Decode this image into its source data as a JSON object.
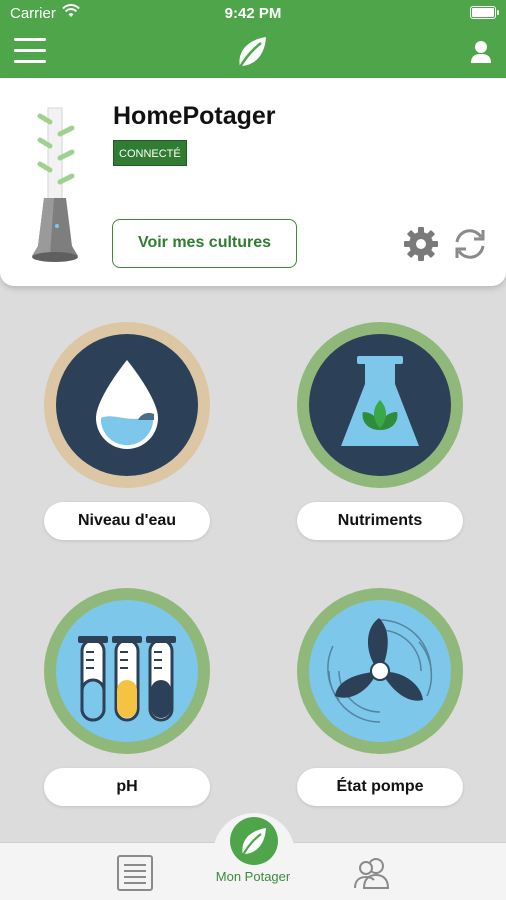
{
  "status_bar": {
    "carrier": "Carrier",
    "time": "9:42 PM"
  },
  "nav": {
    "menu_icon": "hamburger-menu-icon",
    "logo_icon": "leaf-logo-icon",
    "profile_icon": "user-profile-icon"
  },
  "device": {
    "name": "HomePotager",
    "status": "CONNECTÉ",
    "cultures_button": "Voir mes cultures",
    "settings_icon": "gear-icon",
    "refresh_icon": "refresh-icon"
  },
  "tiles": [
    {
      "label": "Niveau d'eau",
      "icon": "water-drop-icon",
      "ring_color": "#dcc6a3"
    },
    {
      "label": "Nutriments",
      "icon": "flask-leaves-icon",
      "ring_color": "#8fb87a"
    },
    {
      "label": "pH",
      "icon": "test-tubes-icon",
      "ring_color": "#8fb87a"
    },
    {
      "label": "État pompe",
      "icon": "fan-icon",
      "ring_color": "#8fb87a"
    }
  ],
  "tab_bar": {
    "center_label": "Mon Potager",
    "list_icon": "list-icon",
    "users_icon": "users-icon"
  },
  "colors": {
    "brand_green": "#4ea54a",
    "dark_navy": "#2c4058",
    "light_blue": "#7dc8ea"
  }
}
